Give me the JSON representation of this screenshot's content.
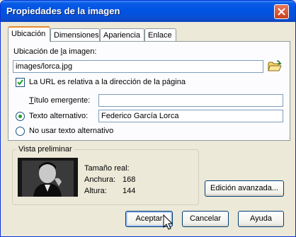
{
  "window": {
    "title": "Propiedades de la imagen"
  },
  "tabs": [
    {
      "label": "Ubicación",
      "active": true
    },
    {
      "label": "Dimensiones",
      "active": false
    },
    {
      "label": "Apariencia",
      "active": false
    },
    {
      "label": "Enlace",
      "active": false
    }
  ],
  "location": {
    "label_prefix": "Ubicación de ",
    "label_accel": "l",
    "label_suffix": "a imagen:",
    "value": "images/lorca.jpg"
  },
  "relative_url": {
    "label": "La URL es relativa a la dirección de la página",
    "checked": true
  },
  "tooltip": {
    "label_accel": "T",
    "label_rest": "ítulo emergente:",
    "value": ""
  },
  "alt_text": {
    "label": "Texto alternativo:",
    "value": "Federico García Lorca",
    "selected": true
  },
  "no_alt": {
    "label": "No usar texto alternativo",
    "selected": false
  },
  "preview": {
    "title": "Vista preliminar",
    "real_size_label": "Tamaño real:",
    "width_label": "Anchura:",
    "width_value": "168",
    "height_label": "Altura:",
    "height_value": "144"
  },
  "buttons": {
    "advanced": "Edición avanzada...",
    "accept": "Aceptar",
    "cancel": "Cancelar",
    "help": "Ayuda"
  },
  "colors": {
    "title_bar": "#0054e3",
    "dialog_bg": "#ece9d8",
    "tab_highlight": "#e68b2c"
  }
}
